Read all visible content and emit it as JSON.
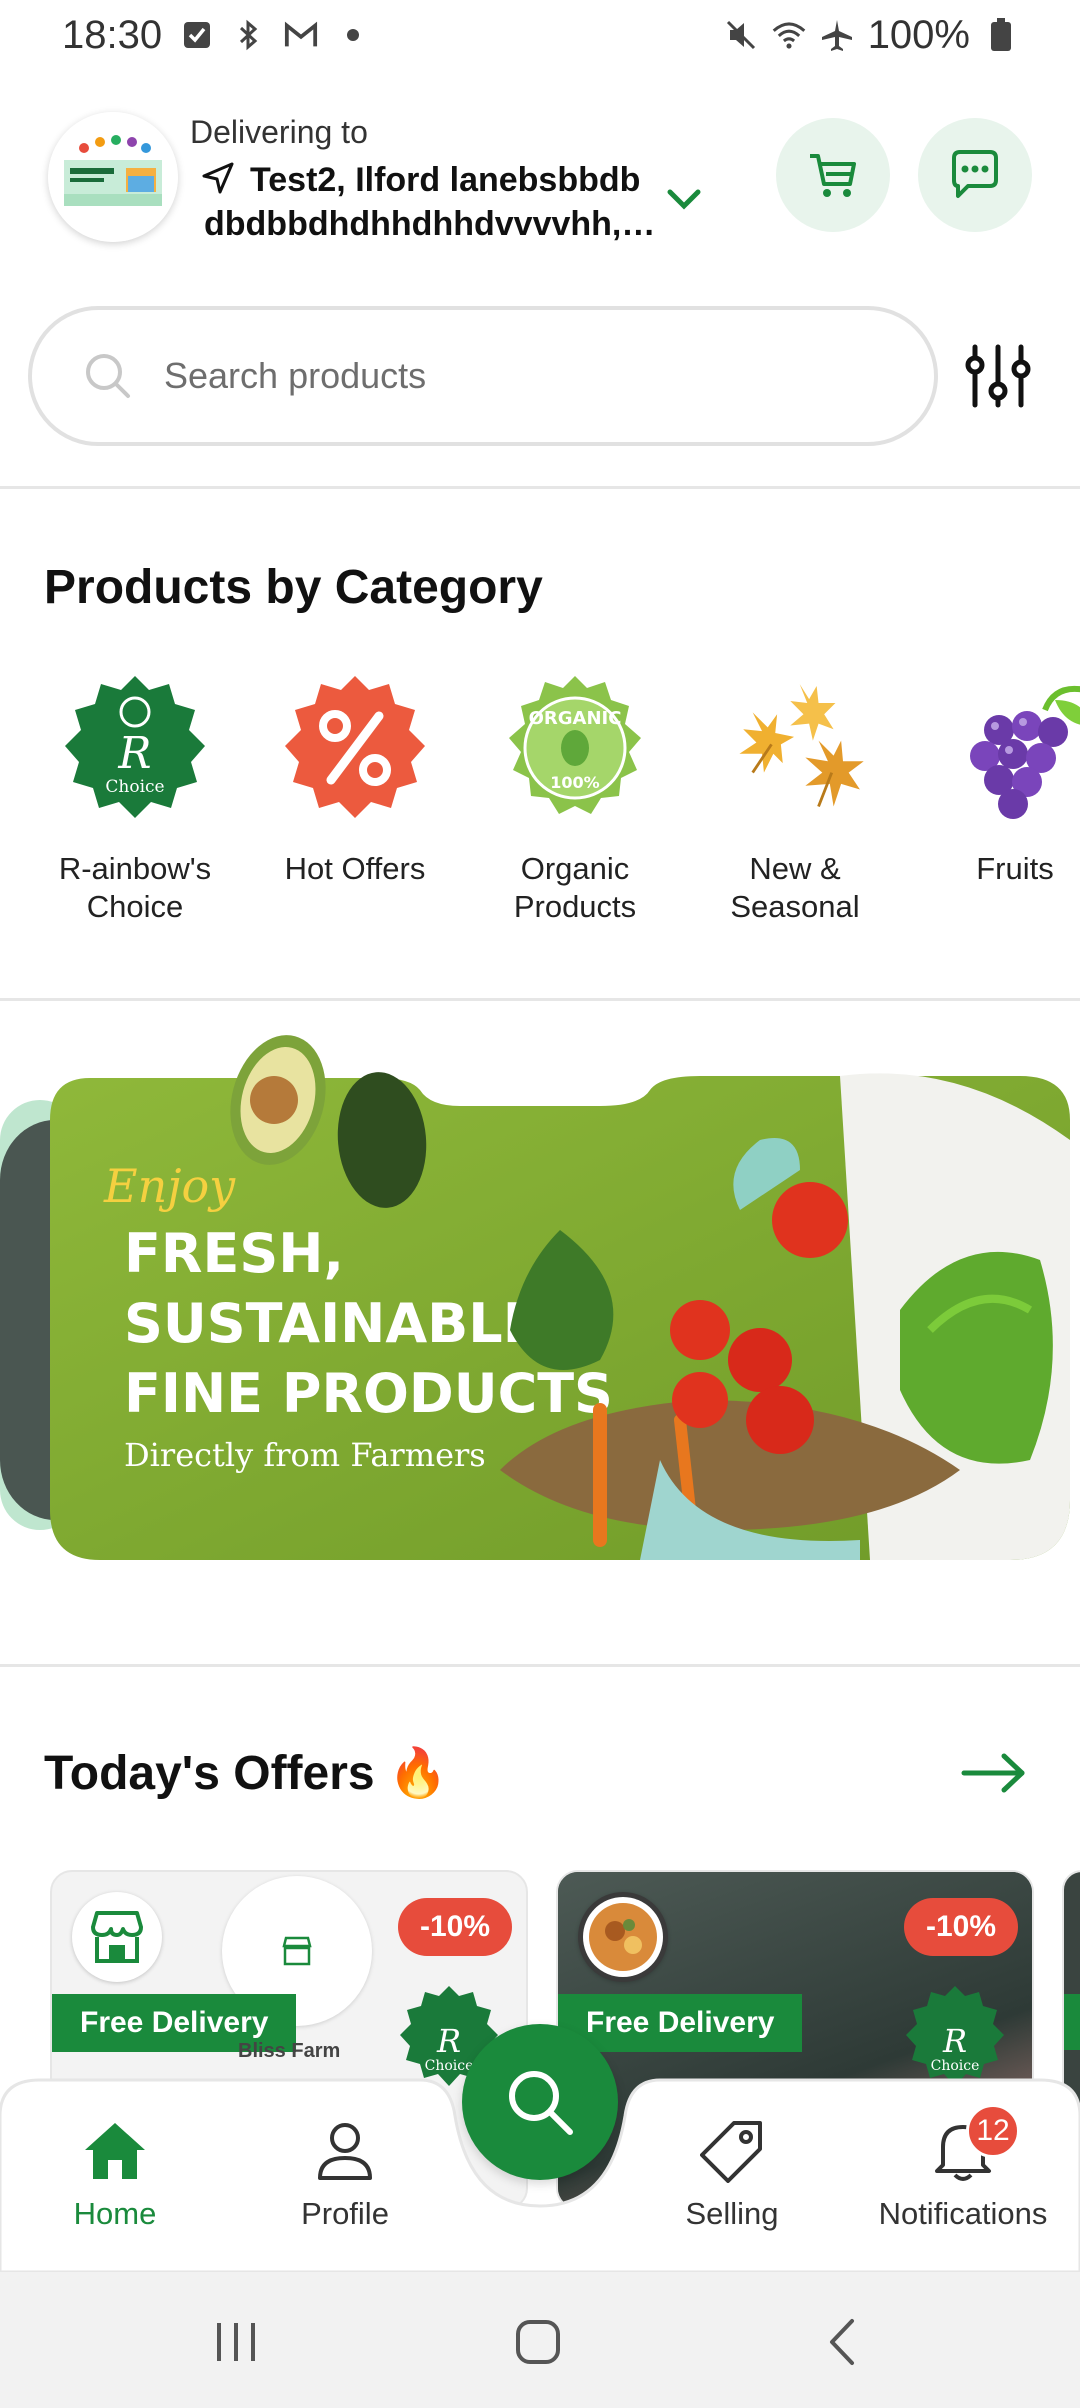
{
  "status_bar": {
    "time": "18:30",
    "battery": "100%",
    "icons": [
      "checkbox-icon",
      "bluetooth-icon",
      "gmail-icon",
      "dot-icon",
      "mute-icon",
      "wifi-icon",
      "airplane-icon",
      "battery-icon"
    ]
  },
  "header": {
    "delivering_label": "Delivering to",
    "address_line1": "Test2, Ilford lanebsbbdb",
    "address_line2": "dbdbbdhdhhdhhdvvvvhh, G...",
    "logo_text": "RAINBOW'S CHOICE"
  },
  "search": {
    "placeholder": "Search products"
  },
  "categories": {
    "title": "Products by Category",
    "items": [
      {
        "line1": "R-ainbow's",
        "line2": "Choice"
      },
      {
        "line1": "Hot Offers",
        "line2": ""
      },
      {
        "line1": "Organic",
        "line2": "Products"
      },
      {
        "line1": "New &",
        "line2": "Seasonal"
      },
      {
        "line1": "Fruits",
        "line2": ""
      }
    ]
  },
  "banner": {
    "enjoy": "Enjoy",
    "line1": "FRESH,",
    "line2": "SUSTAINABLE,",
    "line3": "FINE PRODUCTS",
    "subtitle": "Directly from Farmers"
  },
  "offers": {
    "title": "Today's Offers",
    "emoji": "🔥",
    "cards": [
      {
        "discount": "-10%",
        "free_delivery": "Free Delivery",
        "farm_name": "Bliss Farm",
        "badge_text": "Choice"
      },
      {
        "discount": "-10%",
        "free_delivery": "Free Delivery",
        "badge_text": "Choice"
      }
    ]
  },
  "bottom_nav": {
    "home": "Home",
    "profile": "Profile",
    "selling": "Selling",
    "notifications": "Notifications",
    "notification_count": "12"
  },
  "colors": {
    "brand_green": "#1a8a3c",
    "light_green": "#e8f4ec",
    "badge_red": "#e74c3c"
  }
}
